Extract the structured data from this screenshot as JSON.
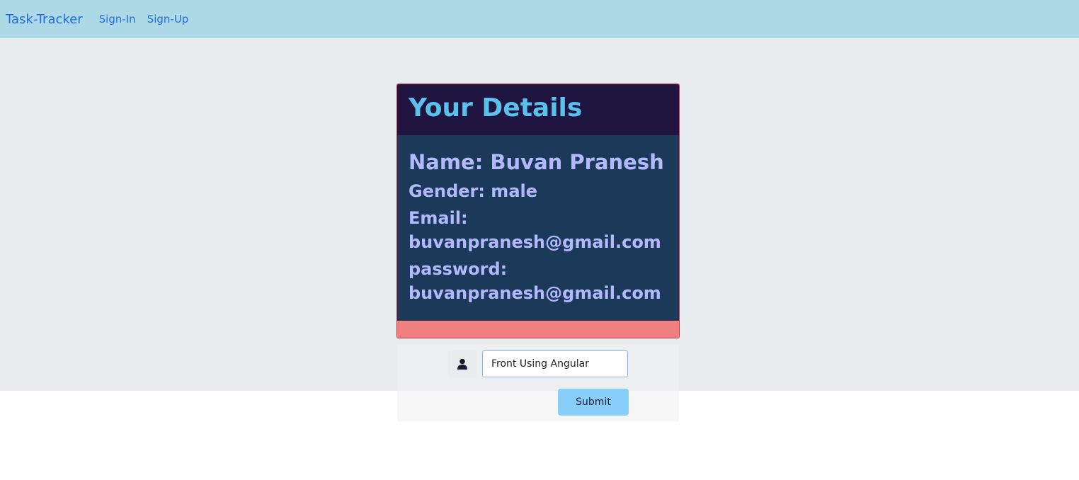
{
  "navbar": {
    "brand": "Task-Tracker",
    "links": [
      "Sign-In",
      "Sign-Up"
    ]
  },
  "card": {
    "title": "Your Details",
    "name": "Name: Buvan Pranesh",
    "gender": "Gender: male",
    "email_label": "Email:",
    "email_value": "buvanpranesh@gmail.com",
    "password_label": "password:",
    "password_value": "buvanpranesh@gmail.com"
  },
  "form": {
    "icon": "user-icon",
    "input_value": "Front Using Angular",
    "submit_label": "Submit"
  },
  "colors": {
    "navbar_bg": "#add8e6",
    "link": "#1f6fe0",
    "card_header_bg": "#201440",
    "card_title": "#5bc0eb",
    "card_body_bg": "#1b3a5a",
    "card_text": "#b4b8ff",
    "card_footer_bg": "#f08080",
    "submit_bg": "#87cefa"
  }
}
